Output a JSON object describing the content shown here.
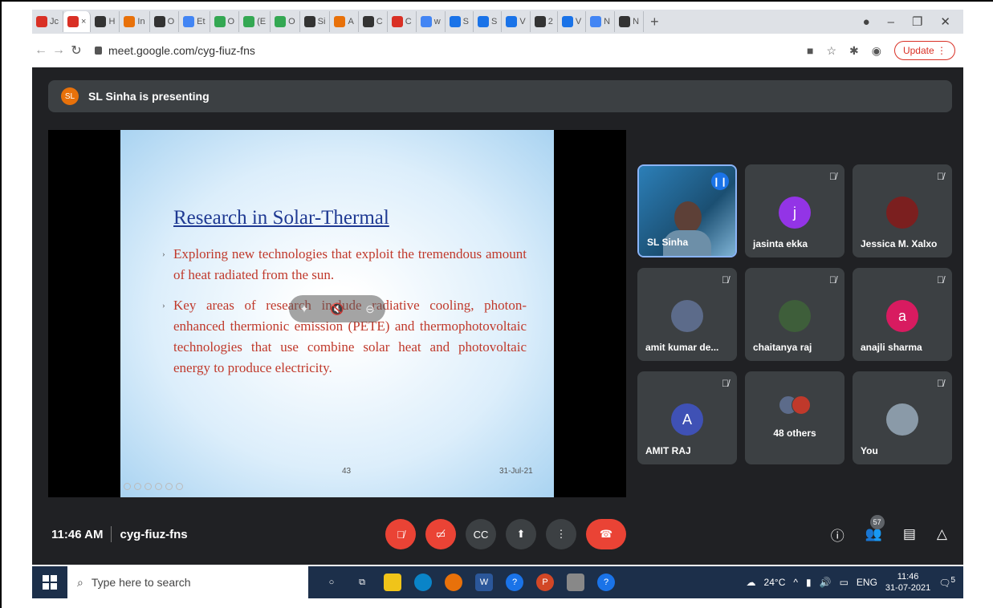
{
  "browser": {
    "tabs": [
      {
        "label": "Jc",
        "color": "#d93025"
      },
      {
        "label": "×",
        "color": "#d93025"
      },
      {
        "label": "H",
        "color": "#333333"
      },
      {
        "label": "In",
        "color": "#e8710a"
      },
      {
        "label": "O",
        "color": "#333333"
      },
      {
        "label": "Et",
        "color": "#4285f4"
      },
      {
        "label": "O",
        "color": "#34a853"
      },
      {
        "label": "(E",
        "color": "#34a853"
      },
      {
        "label": "O",
        "color": "#34a853"
      },
      {
        "label": "Si",
        "color": "#333333"
      },
      {
        "label": "A",
        "color": "#e8710a"
      },
      {
        "label": "C",
        "color": "#333333"
      },
      {
        "label": "C",
        "color": "#d93025"
      },
      {
        "label": "w",
        "color": "#4285f4"
      },
      {
        "label": "S",
        "color": "#1a73e8"
      },
      {
        "label": "S",
        "color": "#1a73e8"
      },
      {
        "label": "V",
        "color": "#1a73e8"
      },
      {
        "label": "2",
        "color": "#333333"
      },
      {
        "label": "V",
        "color": "#1a73e8"
      },
      {
        "label": "N",
        "color": "#4285f4"
      },
      {
        "label": "N",
        "color": "#333333"
      }
    ],
    "new_tab": "+",
    "url": "meet.google.com/cyg-fiuz-fns",
    "update_label": "Update"
  },
  "meet": {
    "presenting_badge": "SL",
    "presenting_text": "SL Sinha is presenting",
    "slide": {
      "title": "Research in Solar-Thermal",
      "bullet1": "Exploring new technologies that exploit the tremendous amount of heat radiated from the sun.",
      "bullet2": "Key areas of research include radiative cooling, photon-enhanced thermionic emission (PETE) and thermophotovoltaic technologies that use combine solar heat and photovoltaic energy to produce electricity.",
      "page_number": "43",
      "date": "31-Jul-21"
    },
    "participants": [
      {
        "name": "SL Sinha",
        "type": "video"
      },
      {
        "name": "jasinta ekka",
        "initial": "j",
        "color": "#9334e6"
      },
      {
        "name": "Jessica M. Xalxo",
        "type": "photo",
        "color": "#7b1f1f"
      },
      {
        "name": "amit kumar de...",
        "type": "photo",
        "color": "#5c6b8a"
      },
      {
        "name": "chaitanya raj",
        "type": "photo",
        "color": "#3e5e3a"
      },
      {
        "name": "anajli sharma",
        "initial": "a",
        "color": "#d81b60"
      },
      {
        "name": "AMIT RAJ",
        "initial": "A",
        "color": "#3f51b5"
      },
      {
        "name": "48 others",
        "type": "others"
      },
      {
        "name": "You",
        "type": "photo",
        "color": "#8a9aa8"
      }
    ],
    "time": "11:46 AM",
    "meeting_code": "cyg-fiuz-fns",
    "people_count": "57",
    "controls": {
      "mic": "mic-off",
      "cam": "camera-off",
      "captions": "CC",
      "present": "present",
      "more": "⋮",
      "end": "end-call"
    }
  },
  "taskbar": {
    "search_placeholder": "Type here to search",
    "weather": "24°C",
    "language": "ENG",
    "clock_time": "11:46",
    "clock_date": "31-07-2021",
    "notifications": "5"
  }
}
